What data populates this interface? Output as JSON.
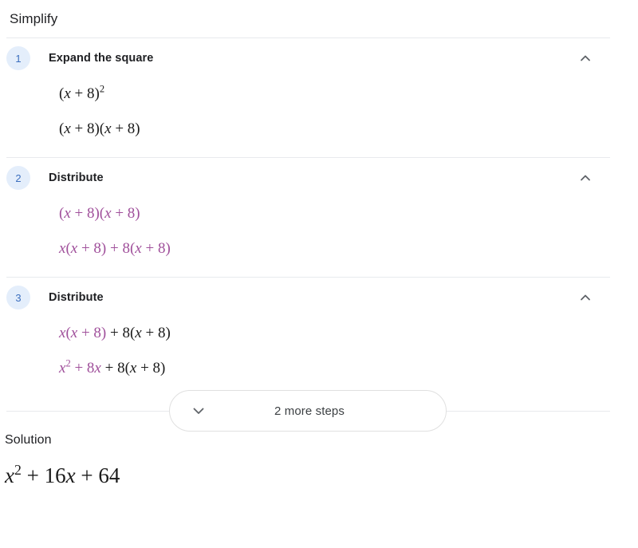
{
  "header": {
    "title": "Simplify"
  },
  "steps": [
    {
      "number": "1",
      "title": "Expand the square",
      "toggle_icon": "chevron-up-icon",
      "lines": [
        {
          "tokens": [
            {
              "text": "(",
              "style": "plain"
            },
            {
              "text": "x",
              "style": "italic"
            },
            {
              "text": " + 8)",
              "style": "plain"
            },
            {
              "text": "2",
              "style": "sup"
            }
          ]
        },
        {
          "tokens": [
            {
              "text": "(",
              "style": "plain"
            },
            {
              "text": "x",
              "style": "italic"
            },
            {
              "text": " + 8)(",
              "style": "plain"
            },
            {
              "text": "x",
              "style": "italic"
            },
            {
              "text": " + 8)",
              "style": "plain"
            }
          ]
        }
      ]
    },
    {
      "number": "2",
      "title": "Distribute",
      "toggle_icon": "chevron-up-icon",
      "lines": [
        {
          "tokens": [
            {
              "text": "(",
              "style": "hl"
            },
            {
              "text": "x",
              "style": "hl-italic"
            },
            {
              "text": " + 8)(",
              "style": "hl"
            },
            {
              "text": "x",
              "style": "hl-italic"
            },
            {
              "text": " + 8)",
              "style": "hl"
            }
          ]
        },
        {
          "tokens": [
            {
              "text": "x",
              "style": "hl-italic"
            },
            {
              "text": "(",
              "style": "hl"
            },
            {
              "text": "x",
              "style": "hl-italic"
            },
            {
              "text": " + 8) + 8(",
              "style": "hl"
            },
            {
              "text": "x",
              "style": "hl-italic"
            },
            {
              "text": " + 8)",
              "style": "hl"
            }
          ]
        }
      ]
    },
    {
      "number": "3",
      "title": "Distribute",
      "toggle_icon": "chevron-up-icon",
      "lines": [
        {
          "tokens": [
            {
              "text": "x",
              "style": "hl-italic"
            },
            {
              "text": "(",
              "style": "hl"
            },
            {
              "text": "x",
              "style": "hl-italic"
            },
            {
              "text": " + 8)",
              "style": "hl"
            },
            {
              "text": " + 8(",
              "style": "plain"
            },
            {
              "text": "x",
              "style": "italic"
            },
            {
              "text": " + 8)",
              "style": "plain"
            }
          ]
        },
        {
          "tokens": [
            {
              "text": "x",
              "style": "hl-italic"
            },
            {
              "text": "2",
              "style": "hl-sup"
            },
            {
              "text": " + 8",
              "style": "hl"
            },
            {
              "text": "x",
              "style": "hl-italic"
            },
            {
              "text": " + 8(",
              "style": "plain"
            },
            {
              "text": "x",
              "style": "italic"
            },
            {
              "text": " + 8)",
              "style": "plain"
            }
          ]
        }
      ]
    }
  ],
  "more_steps": {
    "label": "2 more steps",
    "icon": "chevron-down-icon"
  },
  "solution": {
    "title": "Solution",
    "tokens": [
      {
        "text": "x",
        "style": "italic"
      },
      {
        "text": "2",
        "style": "sup"
      },
      {
        "text": " + 16",
        "style": "plain"
      },
      {
        "text": "x",
        "style": "italic"
      },
      {
        "text": " + 64",
        "style": "plain"
      }
    ]
  },
  "colors": {
    "highlight": "#a0509b",
    "badge_bg": "#e4eefb",
    "badge_text": "#3c6fbe",
    "divider": "#e8eaed",
    "text": "#202124"
  }
}
